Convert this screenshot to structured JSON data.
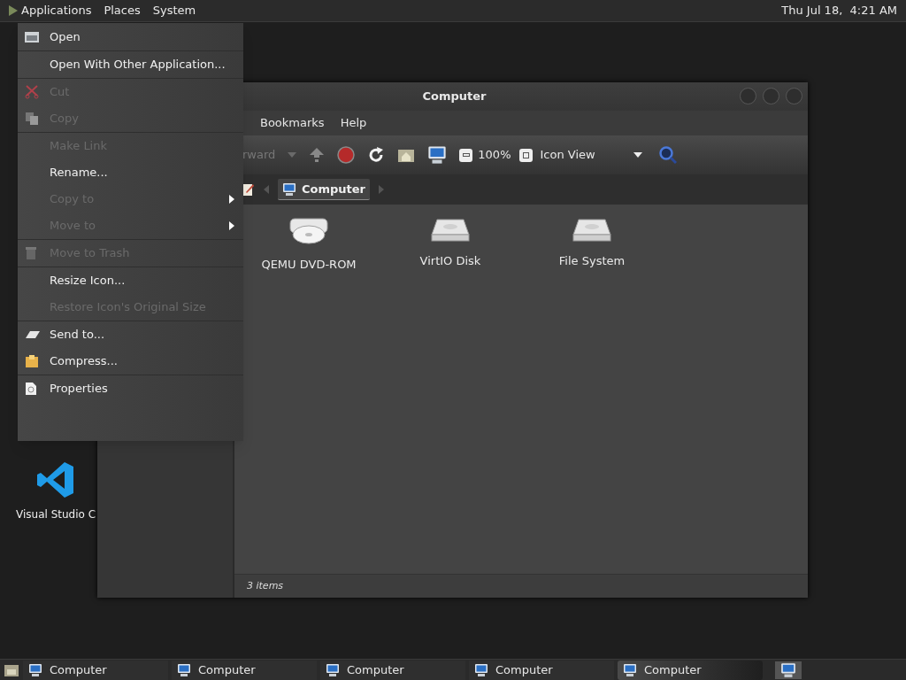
{
  "top_panel": {
    "menus": [
      "Applications",
      "Places",
      "System"
    ],
    "clock": "Thu Jul 18,  4:21 AM"
  },
  "desktop_icons": [
    {
      "label": "Visual Studio C"
    }
  ],
  "window": {
    "title": "Computer",
    "menus": [
      "Bookmarks",
      "Help"
    ],
    "toolbar": {
      "forward_label": "rward",
      "zoom": "100%",
      "view": "Icon View"
    },
    "path": [
      {
        "label": "Computer",
        "selected": true
      }
    ],
    "files": [
      {
        "label": "QEMU DVD-ROM",
        "kind": "optical"
      },
      {
        "label": "VirtIO Disk",
        "kind": "disk"
      },
      {
        "label": "File System",
        "kind": "disk"
      }
    ],
    "status": "3 items"
  },
  "context_menu": [
    {
      "kind": "item",
      "label": "Open",
      "disabled": false,
      "submenu": false
    },
    {
      "kind": "separator"
    },
    {
      "kind": "item",
      "label": "Open With Other Application...",
      "disabled": false,
      "submenu": false
    },
    {
      "kind": "separator"
    },
    {
      "kind": "item",
      "label": "Cut",
      "disabled": true,
      "submenu": false
    },
    {
      "kind": "item",
      "label": "Copy",
      "disabled": true,
      "submenu": false
    },
    {
      "kind": "separator"
    },
    {
      "kind": "item",
      "label": "Make Link",
      "disabled": true,
      "submenu": false
    },
    {
      "kind": "item",
      "label": "Rename...",
      "disabled": false,
      "submenu": false
    },
    {
      "kind": "item",
      "label": "Copy to",
      "disabled": true,
      "submenu": true
    },
    {
      "kind": "item",
      "label": "Move to",
      "disabled": true,
      "submenu": true
    },
    {
      "kind": "separator"
    },
    {
      "kind": "item",
      "label": "Move to Trash",
      "disabled": true,
      "submenu": false
    },
    {
      "kind": "separator"
    },
    {
      "kind": "item",
      "label": "Resize Icon...",
      "disabled": false,
      "submenu": false
    },
    {
      "kind": "item",
      "label": "Restore Icon's Original Size",
      "disabled": true,
      "submenu": false
    },
    {
      "kind": "separator"
    },
    {
      "kind": "item",
      "label": "Send to...",
      "disabled": false,
      "submenu": false
    },
    {
      "kind": "item",
      "label": "Compress...",
      "disabled": false,
      "submenu": false
    },
    {
      "kind": "separator"
    },
    {
      "kind": "item",
      "label": "Properties",
      "disabled": false,
      "submenu": false
    }
  ],
  "taskbar": [
    {
      "label": "Computer",
      "selected": false
    },
    {
      "label": "Computer",
      "selected": false
    },
    {
      "label": "Computer",
      "selected": false
    },
    {
      "label": "Computer",
      "selected": false
    },
    {
      "label": "Computer",
      "selected": true
    }
  ]
}
